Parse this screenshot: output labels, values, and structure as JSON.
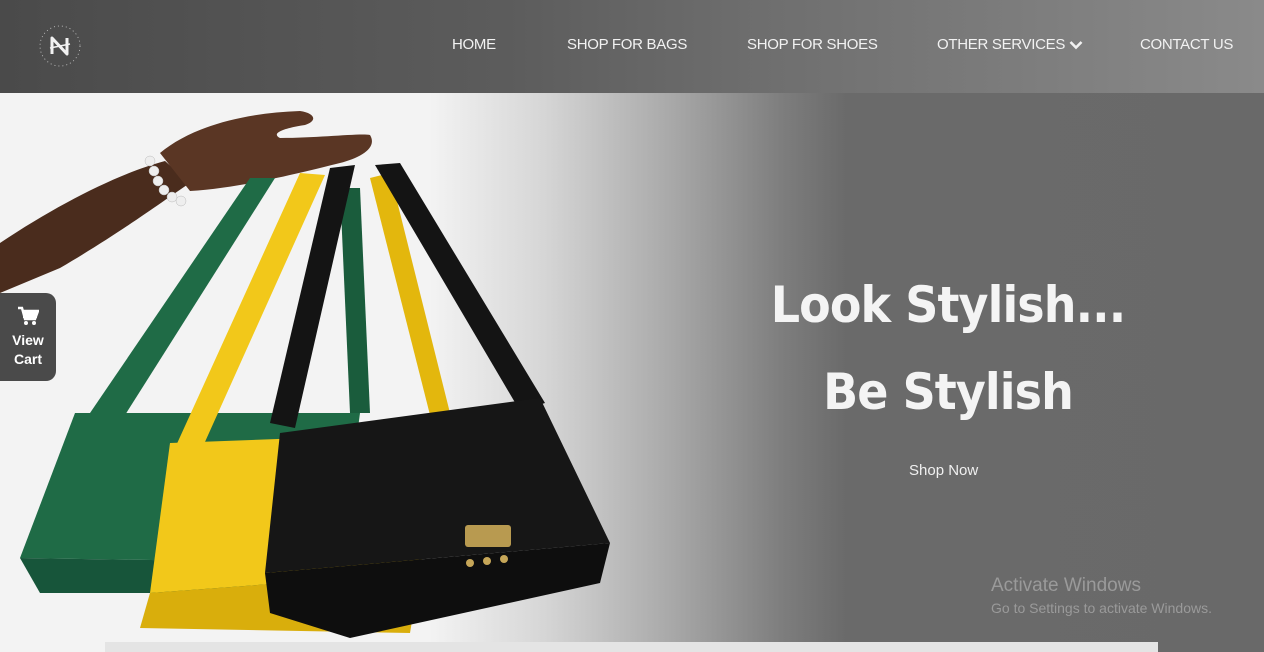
{
  "brand": {
    "logo_letter": "N",
    "logo_ring_text": "N E O N"
  },
  "nav": {
    "items": [
      {
        "label": "HOME"
      },
      {
        "label": "SHOP FOR BAGS"
      },
      {
        "label": "SHOP FOR SHOES"
      },
      {
        "label": "OTHER SERVICES"
      },
      {
        "label": "CONTACT US"
      }
    ]
  },
  "hero": {
    "headline_1": "Look Stylish...",
    "headline_2": "Be Stylish",
    "cta": "Shop Now"
  },
  "cart": {
    "line1": "View",
    "line2": "Cart",
    "icon": "cart-icon"
  },
  "watermark": {
    "title": "Activate Windows",
    "subtitle": "Go to Settings to activate Windows."
  },
  "colors": {
    "header_dark": "#4a4a4a",
    "hero_right": "#696969",
    "bag_green": "#1f6b46",
    "bag_yellow": "#f2c81a",
    "bag_black": "#141414"
  }
}
